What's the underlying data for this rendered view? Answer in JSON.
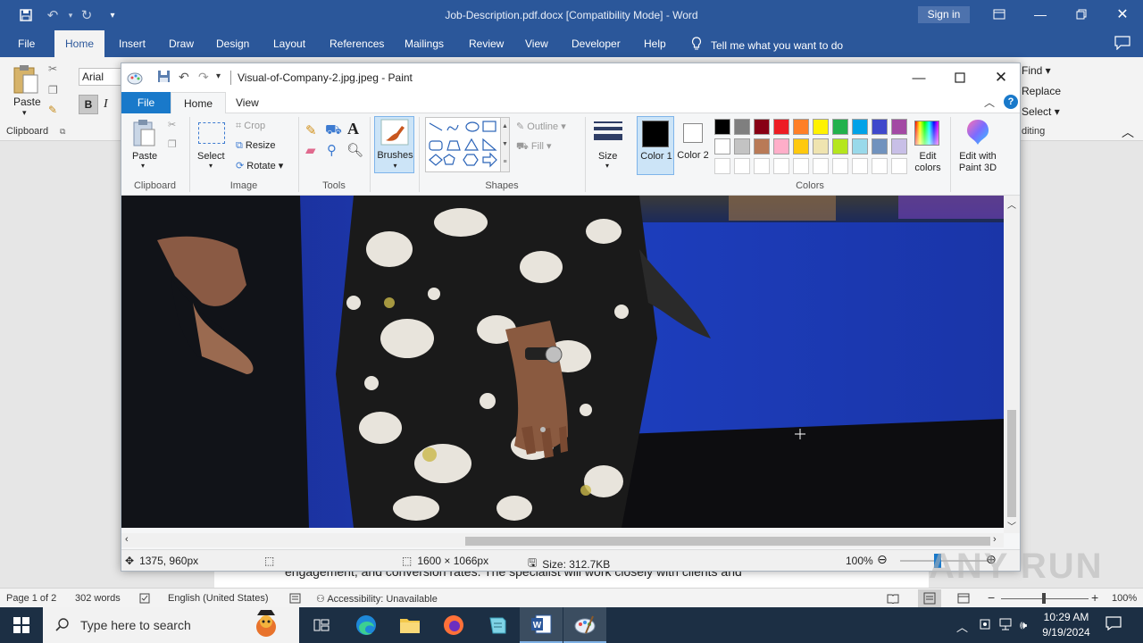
{
  "word": {
    "doc_title": "Job-Description.pdf.docx [Compatibility Mode] - Word",
    "sign_in": "Sign in",
    "tabs": [
      "File",
      "Home",
      "Insert",
      "Draw",
      "Design",
      "Layout",
      "References",
      "Mailings",
      "Review",
      "View",
      "Developer",
      "Help"
    ],
    "tell_me": "Tell me what you want to do",
    "font_name": "Arial",
    "paste_label": "Paste",
    "clipboard_label": "Clipboard",
    "find_label": "Find",
    "replace_label": "Replace",
    "select_label": "Select",
    "editing_label": "diting",
    "bold_label": "B",
    "italic_label": "I",
    "doc_line": "engagement, and conversion rates. The specialist will work closely with clients and",
    "status": {
      "page": "Page 1 of 2",
      "words": "302 words",
      "language": "English (United States)",
      "accessibility": "Accessibility: Unavailable",
      "zoom": "100%"
    }
  },
  "paint": {
    "title": "Visual-of-Company-2.jpg.jpeg - Paint",
    "tabs": {
      "file": "File",
      "home": "Home",
      "view": "View"
    },
    "ribbon": {
      "paste": "Paste",
      "clipboard": "Clipboard",
      "select": "Select",
      "crop": "Crop",
      "resize": "Resize",
      "rotate": "Rotate",
      "image": "Image",
      "tools": "Tools",
      "brushes": "Brushes",
      "outline": "Outline",
      "fill": "Fill",
      "shapes": "Shapes",
      "size": "Size",
      "color1": "Color 1",
      "color2": "Color 2",
      "colors": "Colors",
      "edit_colors": "Edit colors",
      "edit_paint3d": "Edit with Paint 3D"
    },
    "palette_row1": [
      "#000000",
      "#7f7f7f",
      "#880015",
      "#ed1c24",
      "#ff7f27",
      "#fff200",
      "#22b14c",
      "#00a2e8",
      "#3f48cc",
      "#a349a4"
    ],
    "palette_row2": [
      "#ffffff",
      "#c3c3c3",
      "#b97a57",
      "#ffaec9",
      "#ffc90e",
      "#efe4b0",
      "#b5e61d",
      "#99d9ea",
      "#7092be",
      "#c8bfe7"
    ],
    "color1_value": "#000000",
    "color2_value": "#ffffff",
    "status": {
      "cursor_pos": "1375, 960px",
      "dimensions": "1600 × 1066px",
      "size": "Size: 312.7KB",
      "zoom": "100%"
    }
  },
  "taskbar": {
    "search_placeholder": "Type here to search",
    "time": "10:29 AM",
    "date": "9/19/2024"
  },
  "watermark": "ANY RUN"
}
